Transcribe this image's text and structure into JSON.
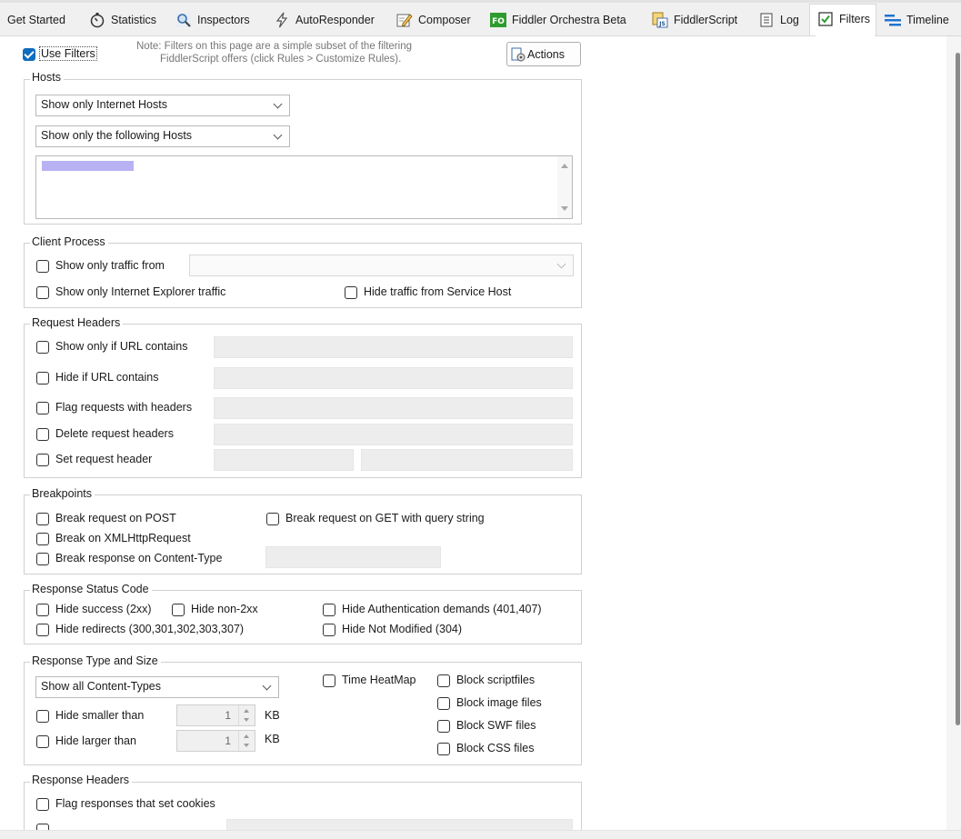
{
  "tabs": [
    {
      "label": "Get Started",
      "icon": "none"
    },
    {
      "label": "Statistics",
      "icon": "stopwatch-icon"
    },
    {
      "label": "Inspectors",
      "icon": "magnifier-icon"
    },
    {
      "label": "AutoResponder",
      "icon": "lightning-icon"
    },
    {
      "label": "Composer",
      "icon": "pencil-icon"
    },
    {
      "label": "Fiddler Orchestra Beta",
      "icon": "fo-badge-icon",
      "badge": "FO"
    },
    {
      "label": "FiddlerScript",
      "icon": "script-icon",
      "badge": "JS"
    },
    {
      "label": "Log",
      "icon": "log-icon"
    },
    {
      "label": "Filters",
      "icon": "checkbox-icon",
      "active": true
    },
    {
      "label": "Timeline",
      "icon": "timeline-icon"
    }
  ],
  "colors": {
    "accent": "#0f6cbd",
    "fo_green": "#2e9b2e",
    "redaction": "#b9b2f2"
  },
  "top": {
    "use_filters": {
      "label": "Use Filters",
      "checked": true
    },
    "note_line1": "Note: Filters on this page are a simple subset of the filtering",
    "note_line2": "FiddlerScript offers (click Rules > Customize Rules).",
    "actions_label": "Actions"
  },
  "hosts": {
    "title": "Hosts",
    "zone_select": "Show only Internet Hosts",
    "host_filter_select": "Show only the following Hosts"
  },
  "client_process": {
    "title": "Client Process",
    "show_only_from": "Show only traffic from",
    "show_only_ie": "Show only Internet Explorer traffic",
    "hide_service_host": "Hide traffic from Service Host"
  },
  "request_headers": {
    "title": "Request Headers",
    "rows": [
      "Show only if URL contains",
      "Hide if URL contains",
      "Flag requests with headers",
      "Delete request headers",
      "Set request header"
    ]
  },
  "breakpoints": {
    "title": "Breakpoints",
    "post": "Break request on POST",
    "get_query": "Break request on GET with query string",
    "xhr": "Break on XMLHttpRequest",
    "content_type": "Break response on Content-Type"
  },
  "status_code": {
    "title": "Response Status Code",
    "hide_success": "Hide success (2xx)",
    "hide_non2xx": "Hide non-2xx",
    "hide_auth": "Hide Authentication demands (401,407)",
    "hide_redirects": "Hide redirects (300,301,302,303,307)",
    "hide_not_modified": "Hide Not Modified (304)"
  },
  "type_size": {
    "title": "Response Type and Size",
    "content_select": "Show all Content-Types",
    "time_heatmap": "Time HeatMap",
    "block_script": "Block scriptfiles",
    "block_image": "Block image files",
    "block_swf": "Block SWF files",
    "block_css": "Block CSS files",
    "hide_smaller": "Hide smaller than",
    "hide_larger": "Hide larger than",
    "smaller_value": "1",
    "larger_value": "1",
    "unit": "KB"
  },
  "response_headers": {
    "title": "Response Headers",
    "flag_cookies": "Flag responses that set cookies"
  }
}
